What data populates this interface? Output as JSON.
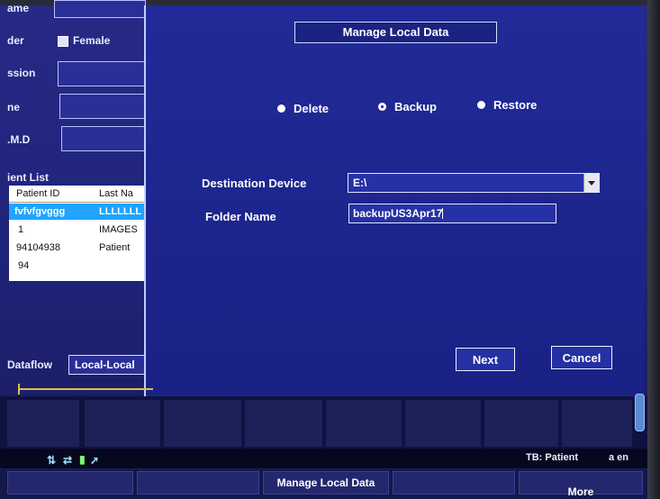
{
  "left_panel": {
    "name_label": "ame",
    "gender_label": "der",
    "gender_value": "Female",
    "accession_label": "ssion",
    "phone_label": "ne",
    "rmd_label": ".M.D",
    "list_title": "ient List",
    "columns": [
      "Patient ID",
      "Last Na"
    ],
    "rows": [
      {
        "id": "fvfvfgvggg",
        "last": "LLLLLLL",
        "selected": true
      },
      {
        "id": "1",
        "last": "IMAGES"
      },
      {
        "id": "94104938",
        "last": "Patient"
      },
      {
        "id": "94",
        "last": ""
      }
    ],
    "dataflow_label": "Dataflow",
    "dataflow_value": "Local-Local"
  },
  "dialog": {
    "title": "Manage Local Data",
    "options": [
      {
        "label": "Delete",
        "selected": false
      },
      {
        "label": "Backup",
        "selected": true
      },
      {
        "label": "Restore",
        "selected": false
      }
    ],
    "destination_label": "Destination Device",
    "destination_value": "E:\\",
    "folder_label": "Folder Name",
    "folder_value": "backupUS3Apr17",
    "next_label": "Next",
    "cancel_label": "Cancel"
  },
  "bottom": {
    "status_tb": "TB: Patient",
    "status_lang": "a en",
    "manage_label": "Manage Local Data",
    "more_label": "More"
  }
}
